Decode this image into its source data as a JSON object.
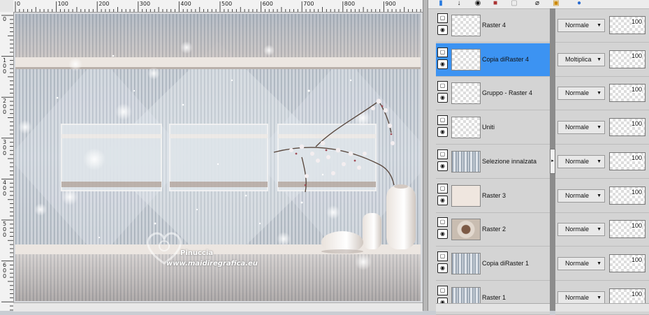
{
  "ruler": {
    "top_ticks": [
      "0",
      "100",
      "200",
      "300",
      "400",
      "500",
      "600",
      "700",
      "800",
      "900"
    ],
    "left_ticks": [
      "0",
      "1\n0\n0",
      "2\n0\n0",
      "3\n0\n0",
      "4\n0\n0",
      "5\n0\n0",
      "6\n0\n0"
    ]
  },
  "watermark": {
    "name": "Pinuccia",
    "site": "www.maidiregrafica.eu"
  },
  "toolbar": {
    "icons": [
      "layer-icon",
      "arrow-down-icon",
      "eye-icon",
      "mask-icon",
      "copy-icon",
      "link-icon",
      "lock-icon",
      "globe-icon"
    ]
  },
  "layers": [
    {
      "name": "Raster 4",
      "blend": "Normale",
      "opacity": "100",
      "selected": false,
      "thumb": "transparent"
    },
    {
      "name": "Copia diRaster 4",
      "blend": "Moltiplica",
      "opacity": "100",
      "selected": true,
      "thumb": "transparent"
    },
    {
      "name": "Gruppo - Raster 4",
      "blend": "Normale",
      "opacity": "100",
      "selected": false,
      "thumb": "transparent"
    },
    {
      "name": "Uniti",
      "blend": "Normale",
      "opacity": "100",
      "selected": false,
      "thumb": "transparent"
    },
    {
      "name": "Selezione innalzata",
      "blend": "Normale",
      "opacity": "100",
      "selected": false,
      "thumb": "stripes"
    },
    {
      "name": "Raster 3",
      "blend": "Normale",
      "opacity": "100",
      "selected": false,
      "thumb": "beige"
    },
    {
      "name": "Raster 2",
      "blend": "Normale",
      "opacity": "100",
      "selected": false,
      "thumb": "flower"
    },
    {
      "name": "Copia diRaster 1",
      "blend": "Normale",
      "opacity": "100",
      "selected": false,
      "thumb": "stripes"
    },
    {
      "name": "Raster 1",
      "blend": "Normale",
      "opacity": "100",
      "selected": false,
      "thumb": "stripes"
    }
  ],
  "colors": {
    "selection": "#3c93f2",
    "panel": "#d4d4d4"
  }
}
